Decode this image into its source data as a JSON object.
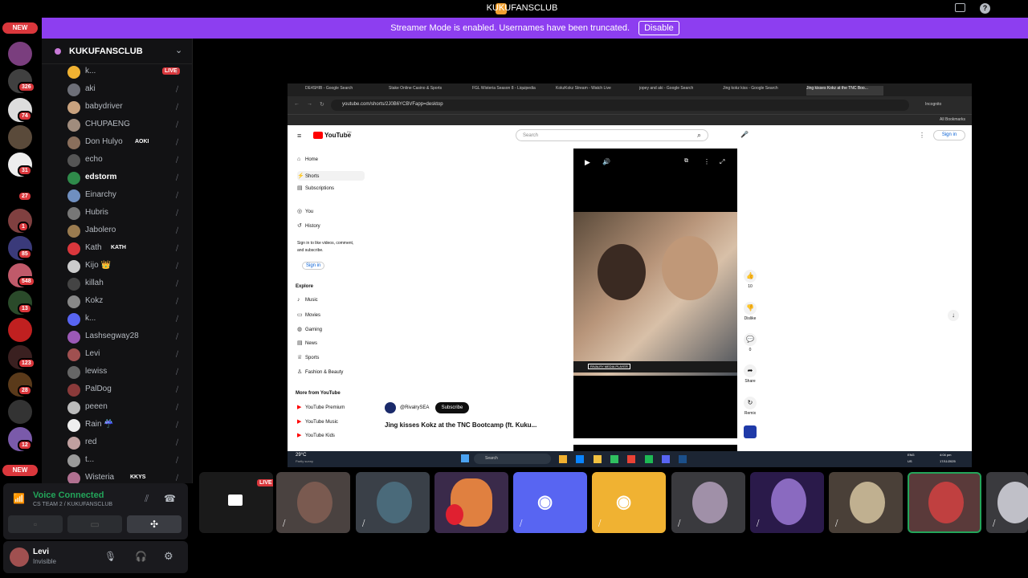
{
  "window": {
    "title": "KUKUFANSCLUB"
  },
  "banner": {
    "text": "Streamer Mode is enabled. Usernames have been truncated.",
    "button": "Disable"
  },
  "guilds": {
    "new_top": "NEW",
    "new_bottom": "NEW",
    "badges": [
      "326",
      "74",
      "31",
      "27",
      "1",
      "85",
      "548",
      "13",
      "123",
      "28",
      "12"
    ]
  },
  "server": {
    "name": "KUKUFANSCLUB"
  },
  "members": [
    {
      "name": "k...",
      "live": "LIVE",
      "color": "#f0b232"
    },
    {
      "name": "aki",
      "color": "#6d6f78"
    },
    {
      "name": "babydriver",
      "color": "#c9a27e"
    },
    {
      "name": "CHUPAENG",
      "color": "#a08c7d"
    },
    {
      "name": "Don Hulyo",
      "tag": "AOKI",
      "color": "#8a6f5c"
    },
    {
      "name": "echo",
      "color": "#555"
    },
    {
      "name": "edstorm",
      "color": "#2f8a4a",
      "bright": true
    },
    {
      "name": "Einarchy",
      "color": "#6f8fc0"
    },
    {
      "name": "Hubris",
      "color": "#777"
    },
    {
      "name": "Jabolero",
      "color": "#9a7b4f"
    },
    {
      "name": "Kath",
      "tag": "KATH",
      "color": "#da373c"
    },
    {
      "name": "Kijo 👑",
      "color": "#ccc"
    },
    {
      "name": "killah",
      "color": "#444"
    },
    {
      "name": "Kokz",
      "color": "#888"
    },
    {
      "name": "k...",
      "color": "#5865f2"
    },
    {
      "name": "Lashsegway28",
      "color": "#9b59b6"
    },
    {
      "name": "Levi",
      "color": "#a05050"
    },
    {
      "name": "lewiss",
      "color": "#666"
    },
    {
      "name": "PalDog",
      "color": "#8a3a3a"
    },
    {
      "name": "peeen",
      "color": "#bbb"
    },
    {
      "name": "Rain ☔",
      "color": "#eee"
    },
    {
      "name": "red",
      "color": "#c0a0a0"
    },
    {
      "name": "t...",
      "color": "#999"
    },
    {
      "name": "Wisteria",
      "tag": "KKYS",
      "color": "#b07090"
    }
  ],
  "voice": {
    "status": "Voice Connected",
    "channel": "CS TEAM 2 / KUKUFANSCLUB"
  },
  "user": {
    "name": "Levi",
    "status": "Invisible"
  },
  "browser": {
    "tabs": [
      "DE4SHIB - Google Search",
      "Stake Online Casino & Sports",
      "FGL Wisteria Season 8 - Liquipedia",
      "KokzKokz Stream - Watch Live",
      "jopey and aki - Google Search",
      "Jing kokz kiss - Google Search",
      "Jing kisses Kokz at the TNC Boo..."
    ],
    "url": "youtube.com/shorts/2J0B6YCBVFapp=desktop",
    "incognito": "Incognito",
    "bookmarks": "All Bookmarks"
  },
  "youtube": {
    "logo": "YouTube",
    "logo_sup": "PH",
    "search_placeholder": "Search",
    "signin": "Sign in",
    "nav": [
      "Home",
      "Shorts",
      "Subscriptions",
      "You",
      "History"
    ],
    "signin_prompt": "Sign in to like videos, comment, and subscribe.",
    "signin_btn": "Sign in",
    "explore_title": "Explore",
    "explore": [
      "Music",
      "Movies",
      "Gaming",
      "News",
      "Sports",
      "Fashion & Beauty"
    ],
    "more_title": "More from YouTube",
    "more": [
      "YouTube Premium",
      "YouTube Music",
      "YouTube Kids"
    ],
    "channel": "@RivalrySEA",
    "subscribe": "Subscribe",
    "video_title": "Jing kisses Kokz at the TNC Bootcamp (ft. Kuku...",
    "actions": [
      {
        "icon": "👍",
        "label": "10"
      },
      {
        "icon": "👎",
        "label": "Dislike"
      },
      {
        "icon": "💬",
        "label": "0"
      },
      {
        "icon": "➦",
        "label": "Share"
      },
      {
        "icon": "↻",
        "label": "Remix"
      }
    ],
    "overlay": "RIVALRY MEDIA PLAYER"
  },
  "taskbar": {
    "weather": "29°C",
    "weather_sub": "Partly sunny",
    "search": "Search",
    "lang": "ENG",
    "region": "US",
    "time": "4:04 pm",
    "date": "17/11/2025"
  },
  "tiles": {
    "live": "LIVE"
  }
}
